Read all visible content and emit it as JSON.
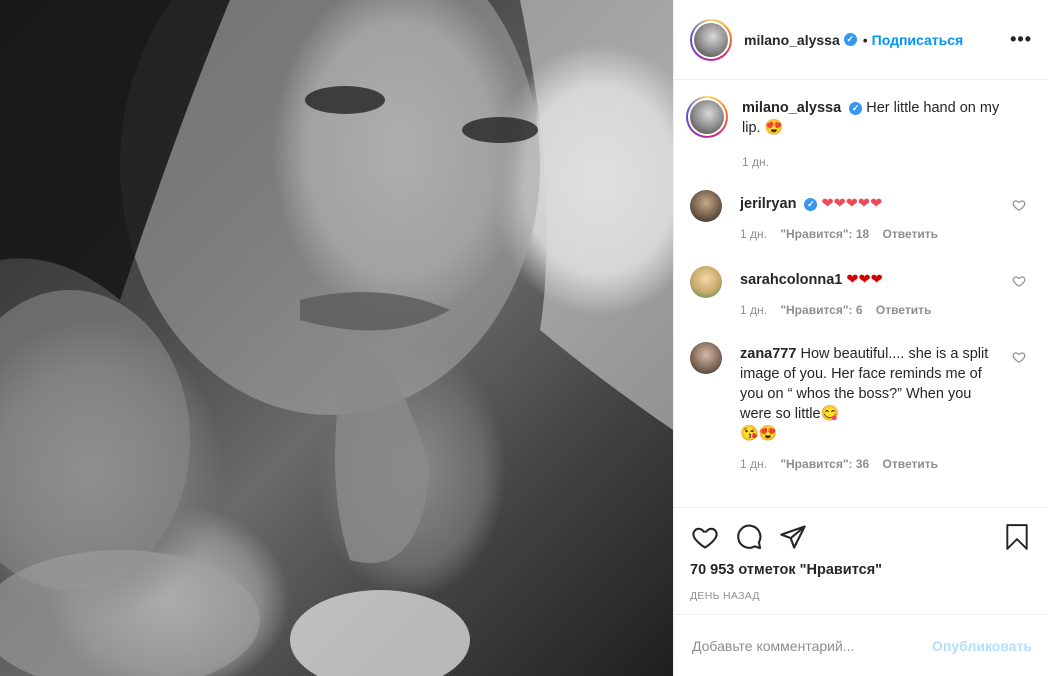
{
  "post": {
    "author": "milano_alyssa",
    "follow_label": "Подписаться",
    "dot": "•",
    "more": "•••",
    "caption_text": "Her little hand on my lip.",
    "caption_emoji": "😍",
    "caption_time": "1 дн."
  },
  "comments": [
    {
      "user": "jerilryan",
      "verified": true,
      "text": "❤❤❤❤❤",
      "time": "1 дн.",
      "likes": "\"Нравится\": 18",
      "reply": "Ответить",
      "avatar_color": "#5a4a3a"
    },
    {
      "user": "sarahcolonna1",
      "verified": false,
      "text": "❤❤❤",
      "time": "1 дн.",
      "likes": "\"Нравится\": 6",
      "reply": "Ответить",
      "avatar_color": "#c9a86a"
    },
    {
      "user": "zana777",
      "verified": false,
      "text": "How beautiful.... she is a split image of you. Her face reminds me of you on “ whos the boss?” When you were so little",
      "emoji1": "😋",
      "emoji2": "😘😍",
      "time": "1 дн.",
      "likes": "\"Нравится\": 36",
      "reply": "Ответить",
      "avatar_color": "#7a6355"
    }
  ],
  "actions": {
    "like_count": "70 953 отметок \"Нравится\"",
    "time_ago": "ДЕНЬ НАЗАД"
  },
  "add_comment": {
    "placeholder": "Добавьте комментарий...",
    "post_label": "Опубликовать"
  },
  "colors": {
    "accent": "#0095f6",
    "verified": "#3897f0",
    "heart_red": "#ed4956"
  }
}
